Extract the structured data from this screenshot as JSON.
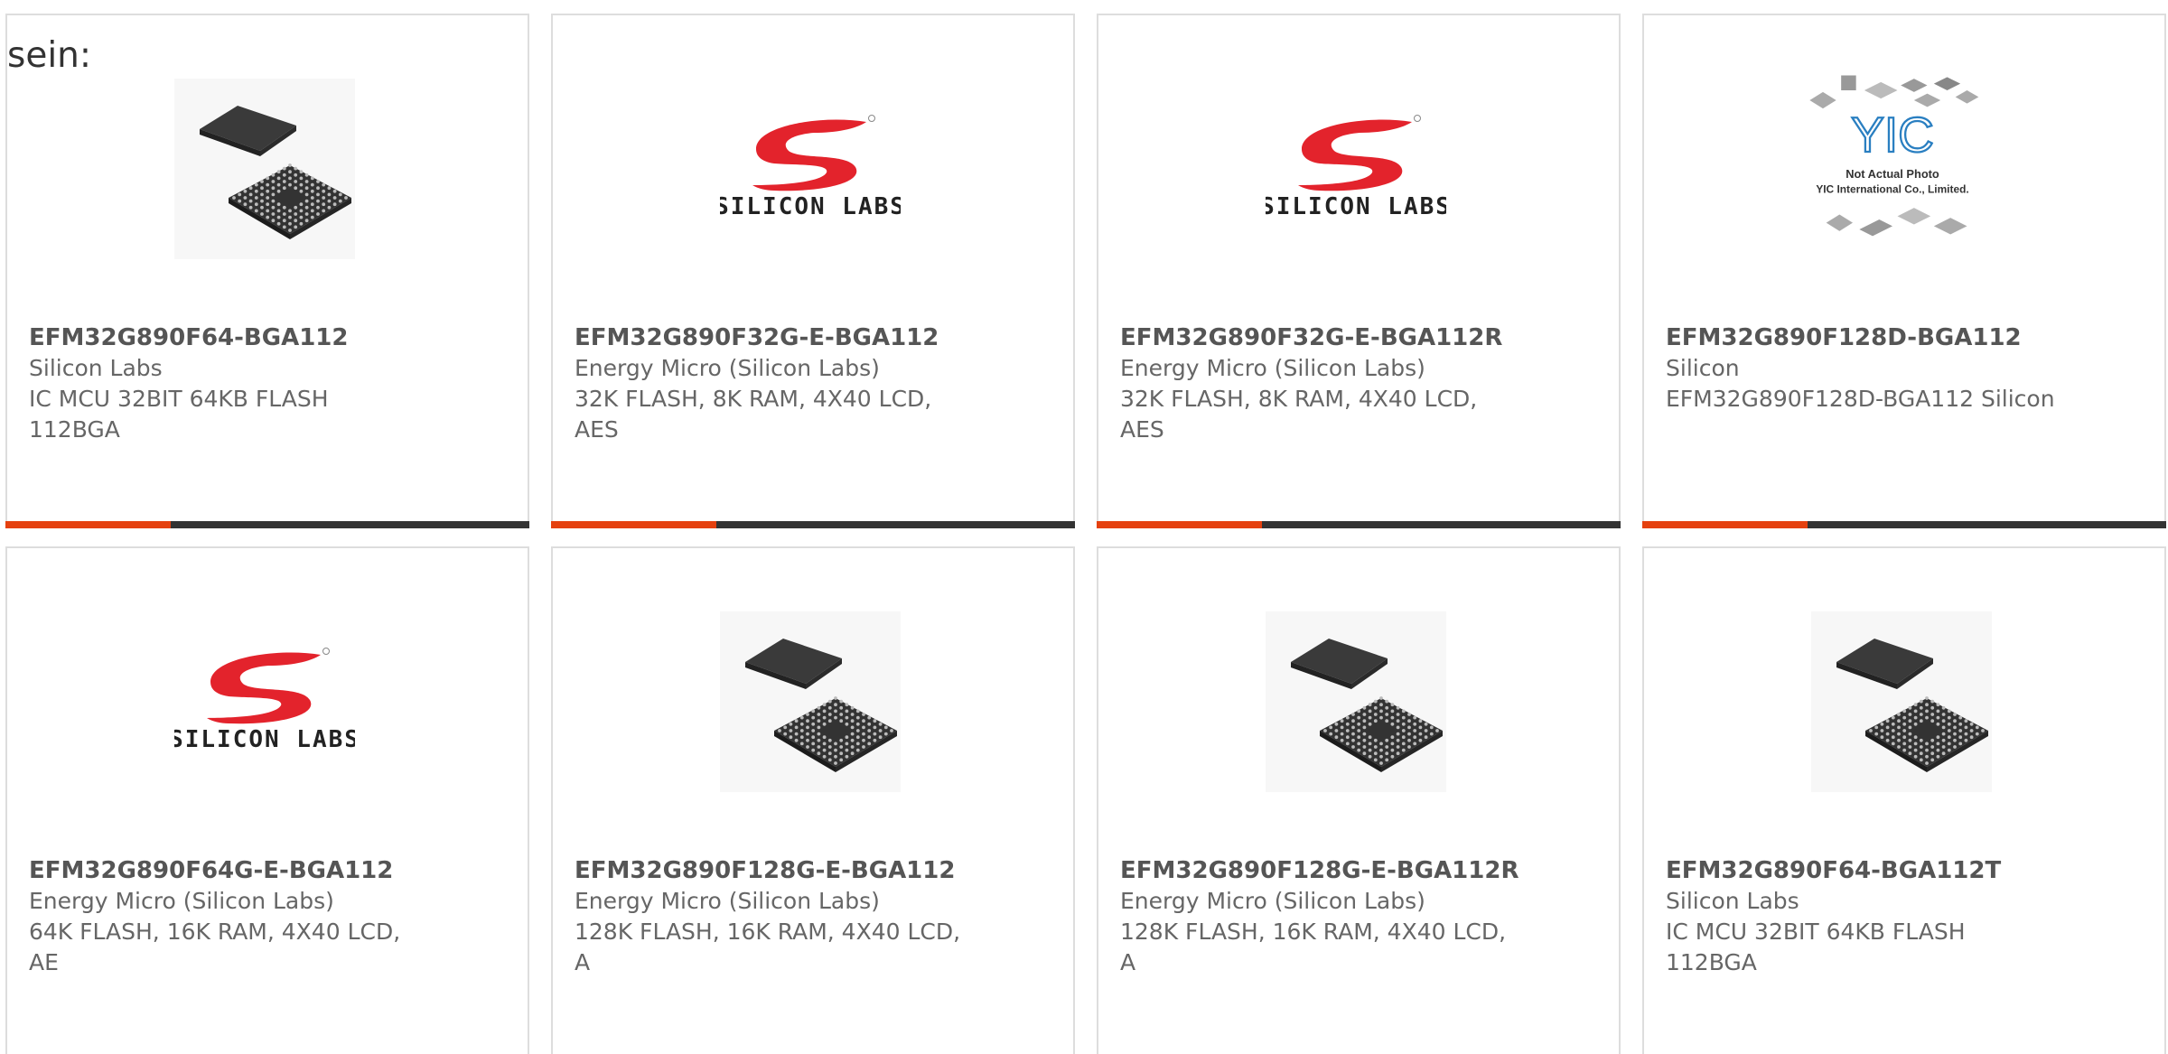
{
  "heading": "sein:",
  "colors": {
    "accent": "#e5410f",
    "bar": "#333333",
    "logo_red": "#e3232c"
  },
  "products": [
    {
      "part_number": "EFM32G890F64-BGA112",
      "manufacturer": "Silicon Labs",
      "description": "IC MCU 32BIT 64KB FLASH 112BGA",
      "image": "bga-chip"
    },
    {
      "part_number": "EFM32G890F32G-E-BGA112",
      "manufacturer": "Energy Micro (Silicon Labs)",
      "description": "32K FLASH, 8K RAM, 4X40 LCD, AES",
      "image": "silicon-labs-logo"
    },
    {
      "part_number": "EFM32G890F32G-E-BGA112R",
      "manufacturer": "Energy Micro (Silicon Labs)",
      "description": "32K FLASH, 8K RAM, 4X40 LCD, AES",
      "image": "silicon-labs-logo"
    },
    {
      "part_number": "EFM32G890F128D-BGA112",
      "manufacturer": "Silicon",
      "description": "EFM32G890F128D-BGA112 Silicon",
      "image": "yic-placeholder"
    },
    {
      "part_number": "EFM32G890F64G-E-BGA112",
      "manufacturer": "Energy Micro (Silicon Labs)",
      "description": "64K FLASH, 16K RAM, 4X40 LCD, AE",
      "image": "silicon-labs-logo"
    },
    {
      "part_number": "EFM32G890F128G-E-BGA112",
      "manufacturer": "Energy Micro (Silicon Labs)",
      "description": "128K FLASH, 16K RAM, 4X40 LCD, A",
      "image": "bga-chip"
    },
    {
      "part_number": "EFM32G890F128G-E-BGA112R",
      "manufacturer": "Energy Micro (Silicon Labs)",
      "description": "128K FLASH, 16K RAM, 4X40 LCD, A",
      "image": "bga-chip"
    },
    {
      "part_number": "EFM32G890F64-BGA112T",
      "manufacturer": "Silicon Labs",
      "description": "IC MCU 32BIT 64KB FLASH 112BGA",
      "image": "bga-chip"
    }
  ],
  "logo_text": {
    "silicon_labs": "SILICON LABS",
    "yic_mark": "YIC",
    "yic_line1": "Not Actual Photo",
    "yic_line2": "YIC International Co., Limited."
  }
}
